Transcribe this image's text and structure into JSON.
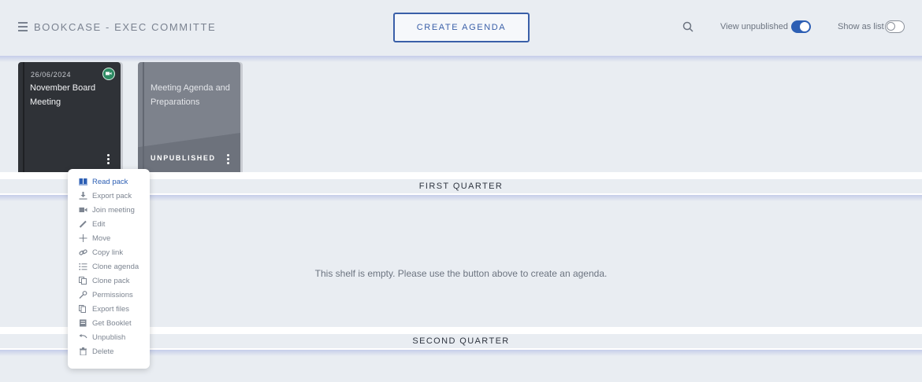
{
  "header": {
    "title": "BOOKCASE - EXEC COMMITTE",
    "create_label": "CREATE AGENDA",
    "view_unpublished_label": "View unpublished",
    "view_unpublished_on": true,
    "show_as_list_label": "Show as list",
    "show_as_list_on": false
  },
  "books": [
    {
      "date": "26/06/2024",
      "title": "November Board Meeting",
      "status": ""
    },
    {
      "date": "",
      "title": "Meeting Agenda and Preparations",
      "status": "UNPUBLISHED"
    }
  ],
  "shelves": {
    "first": "FIRST QUARTER",
    "second": "SECOND QUARTER",
    "empty_message": "This shelf is empty. Please use the button above to create an agenda."
  },
  "menu": {
    "items": [
      {
        "label": "Read pack",
        "icon": "book-icon"
      },
      {
        "label": "Export pack",
        "icon": "download-icon"
      },
      {
        "label": "Join meeting",
        "icon": "video-icon"
      },
      {
        "label": "Edit",
        "icon": "pencil-icon"
      },
      {
        "label": "Move",
        "icon": "move-icon"
      },
      {
        "label": "Copy link",
        "icon": "link-icon"
      },
      {
        "label": "Clone agenda",
        "icon": "list-icon"
      },
      {
        "label": "Clone pack",
        "icon": "copy-icon"
      },
      {
        "label": "Permissions",
        "icon": "key-icon"
      },
      {
        "label": "Export files",
        "icon": "files-icon"
      },
      {
        "label": "Get Booklet",
        "icon": "booklet-icon"
      },
      {
        "label": "Unpublish",
        "icon": "undo-icon"
      },
      {
        "label": "Delete",
        "icon": "trash-icon"
      }
    ]
  },
  "colors": {
    "accent": "#2d5fb4",
    "background": "#e9edf2",
    "camera_badge": "#2e8a63"
  }
}
